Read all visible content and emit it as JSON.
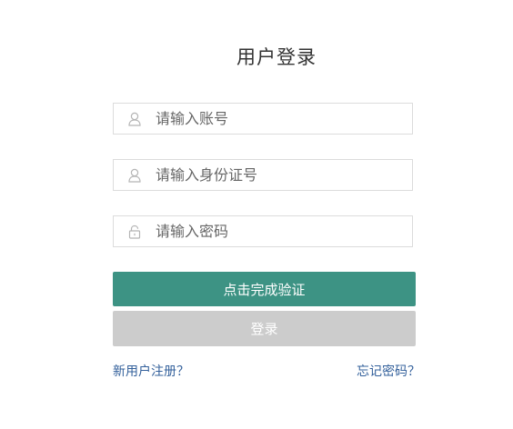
{
  "form": {
    "title": "用户登录",
    "account": {
      "placeholder": "请输入账号",
      "icon": "user-icon"
    },
    "id_card": {
      "placeholder": "请输入身份证号",
      "icon": "user-icon"
    },
    "password": {
      "placeholder": "请输入密码",
      "icon": "lock-icon"
    },
    "verify_button": "点击完成验证",
    "login_button": "登录",
    "register_link": "新用户注册？",
    "forgot_link": "忘记密码？"
  },
  "colors": {
    "verify_button_bg": "#3d9384",
    "login_button_bg": "#cccccc",
    "link": "#33609b",
    "border": "#dcdcdc"
  }
}
